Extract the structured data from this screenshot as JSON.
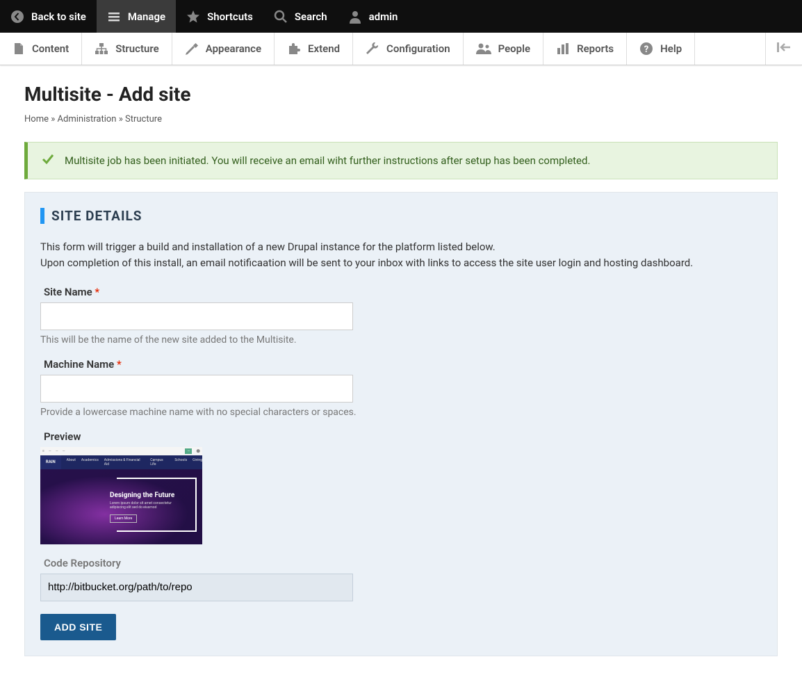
{
  "toolbar_top": {
    "back": "Back to site",
    "manage": "Manage",
    "shortcuts": "Shortcuts",
    "search": "Search",
    "user": "admin"
  },
  "toolbar_admin": {
    "content": "Content",
    "structure": "Structure",
    "appearance": "Appearance",
    "extend": "Extend",
    "configuration": "Configuration",
    "people": "People",
    "reports": "Reports",
    "help": "Help"
  },
  "page": {
    "title": "Multisite - Add site",
    "breadcrumb": {
      "home": "Home",
      "administration": "Administration",
      "structure": "Structure"
    }
  },
  "alert": {
    "message": "Multisite job has been initiated. You will receive an email wiht further instructions after setup has been completed."
  },
  "panel": {
    "heading": "SITE DETAILS",
    "description_line1": "This form will trigger a build and installation of a new Drupal instance for the platform listed below.",
    "description_line2": "Upon completion of this install, an email notificaation will be sent to your inbox with links to access the site user login and hosting dashboard."
  },
  "form": {
    "site_name": {
      "label": "Site Name",
      "value": "",
      "help": "This will be the name of the new site added to the Multisite."
    },
    "machine_name": {
      "label": "Machine Name",
      "value": "",
      "help": "Provide a lowercase machine name with no special characters or spaces."
    },
    "preview": {
      "label": "Preview",
      "brand": "RAIN",
      "hero_title": "Designing the Future",
      "hero_button": "Learn More"
    },
    "code_repo": {
      "label": "Code Repository",
      "value": "http://bitbucket.org/path/to/repo"
    },
    "submit": "ADD SITE"
  }
}
